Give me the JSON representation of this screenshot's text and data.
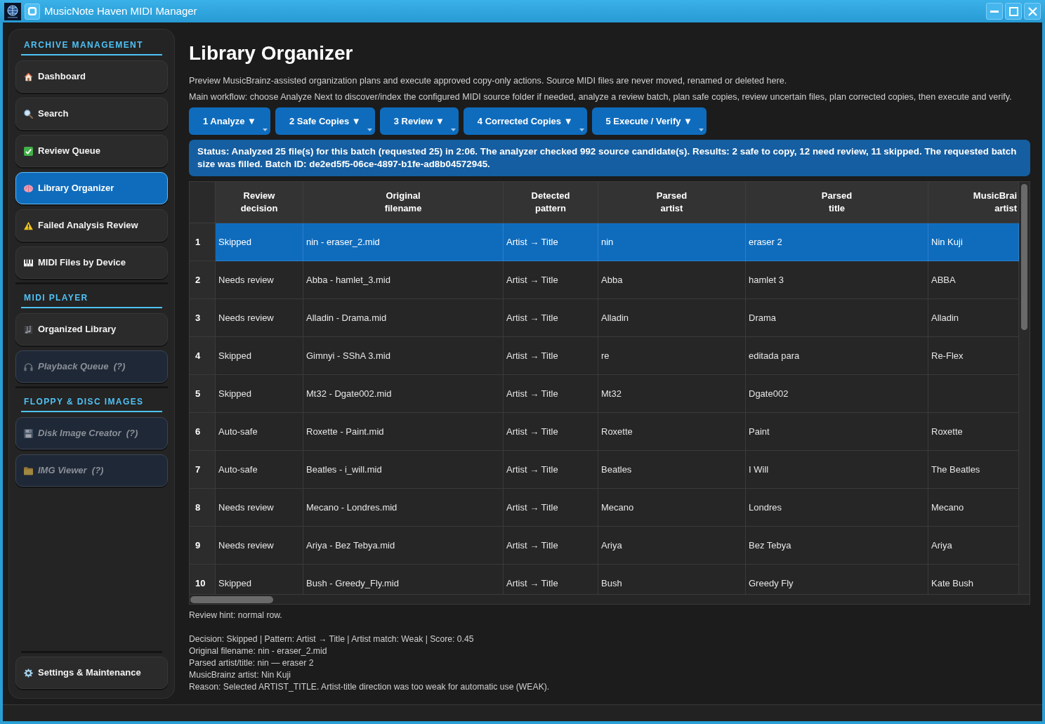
{
  "window": {
    "title": "MusicNote Haven MIDI Manager"
  },
  "sidebar": {
    "sections": [
      {
        "title": "ARCHIVE MANAGEMENT",
        "items": [
          {
            "label": "Dashboard",
            "selected": false,
            "disabled": false
          },
          {
            "label": "Search",
            "selected": false,
            "disabled": false
          },
          {
            "label": "Review Queue",
            "selected": false,
            "disabled": false
          },
          {
            "label": "Library Organizer",
            "selected": true,
            "disabled": false
          },
          {
            "label": "Failed Analysis Review",
            "selected": false,
            "disabled": false
          },
          {
            "label": "MIDI Files by Device",
            "selected": false,
            "disabled": false
          }
        ]
      },
      {
        "title": "MIDI PLAYER",
        "items": [
          {
            "label": "Organized Library",
            "selected": false,
            "disabled": false
          },
          {
            "label": "Playback Queue  (?)",
            "selected": false,
            "disabled": true
          }
        ]
      },
      {
        "title": "FLOPPY & DISC IMAGES",
        "items": [
          {
            "label": "Disk Image Creator  (?)",
            "selected": false,
            "disabled": true
          },
          {
            "label": "IMG Viewer  (?)",
            "selected": false,
            "disabled": true
          }
        ]
      }
    ],
    "footer_items": [
      {
        "label": "Settings & Maintenance",
        "selected": false,
        "disabled": false
      }
    ]
  },
  "page": {
    "title": "Library Organizer",
    "description": [
      "Preview MusicBrainz-assisted organization plans and execute approved copy-only actions. Source MIDI files are never moved, renamed or deleted here.",
      "Main workflow: choose Analyze Next to discover/index the configured MIDI source folder if needed, analyze a review batch, plan safe copies, review uncertain files, plan corrected copies, then execute and verify."
    ]
  },
  "workflow_buttons": [
    {
      "label": "1 Analyze ▼"
    },
    {
      "label": "2 Safe Copies ▼"
    },
    {
      "label": "3 Review ▼"
    },
    {
      "label": "4 Corrected Copies ▼"
    },
    {
      "label": "5 Execute / Verify ▼"
    }
  ],
  "status": "Status: Analyzed 25 file(s) for this batch (requested 25) in 2:06. The analyzer checked 992 source candidate(s). Results: 2 safe to copy, 12 need review, 11 skipped. The requested batch size was filled. Batch ID: de2ed5f5-06ce-4897-b1fe-ad8b04572945.",
  "table": {
    "columns": [
      "Review\ndecision",
      "Original\nfilename",
      "Detected\npattern",
      "Parsed\nartist",
      "Parsed\ntitle",
      "MusicBrai\nartist"
    ],
    "rows": [
      {
        "number": "1",
        "selected": true,
        "cells": [
          "Skipped",
          "nin - eraser_2.mid",
          "Artist → Title",
          "nin",
          "eraser 2",
          "Nin Kuji"
        ]
      },
      {
        "number": "2",
        "selected": false,
        "cells": [
          "Needs review",
          "Abba - hamlet_3.mid",
          "Artist → Title",
          "Abba",
          "hamlet 3",
          "ABBA"
        ]
      },
      {
        "number": "3",
        "selected": false,
        "cells": [
          "Needs review",
          "Alladin - Drama.mid",
          "Artist → Title",
          "Alladin",
          "Drama",
          "Alladin"
        ]
      },
      {
        "number": "4",
        "selected": false,
        "cells": [
          "Skipped",
          "Gimnyi - SShA 3.mid",
          "Artist → Title",
          "re",
          "editada para",
          "Re-Flex"
        ]
      },
      {
        "number": "5",
        "selected": false,
        "cells": [
          "Skipped",
          "Mt32 - Dgate002.mid",
          "Artist → Title",
          "Mt32",
          "Dgate002"
        ]
      },
      {
        "number": "6",
        "selected": false,
        "cells": [
          "Auto-safe",
          "Roxette - Paint.mid",
          "Artist → Title",
          "Roxette",
          "Paint",
          "Roxette"
        ]
      },
      {
        "number": "7",
        "selected": false,
        "cells": [
          "Auto-safe",
          "Beatles - i_will.mid",
          "Artist → Title",
          "Beatles",
          "I Will",
          "The Beatles"
        ]
      },
      {
        "number": "8",
        "selected": false,
        "cells": [
          "Needs review",
          "Mecano - Londres.mid",
          "Artist → Title",
          "Mecano",
          "Londres",
          "Mecano"
        ]
      },
      {
        "number": "9",
        "selected": false,
        "cells": [
          "Needs review",
          "Ariya - Bez Tebya.mid",
          "Artist → Title",
          "Ariya",
          "Bez Tebya",
          "Ariya"
        ]
      },
      {
        "number": "10",
        "selected": false,
        "cells": [
          "Skipped",
          "Bush - Greedy_Fly.mid",
          "Artist → Title",
          "Bush",
          "Greedy Fly",
          "Kate Bush"
        ]
      }
    ]
  },
  "review_hint": "Review hint: normal row.",
  "details": [
    "Decision: Skipped | Pattern: Artist → Title | Artist match: Weak | Score: 0.45",
    "Original filename: nin - eraser_2.mid",
    "Parsed artist/title: nin — eraser 2",
    "MusicBrainz artist: Nin Kuji",
    "Reason: Selected ARTIST_TITLE. Artist-title direction was too weak for automatic use (WEAK)."
  ]
}
